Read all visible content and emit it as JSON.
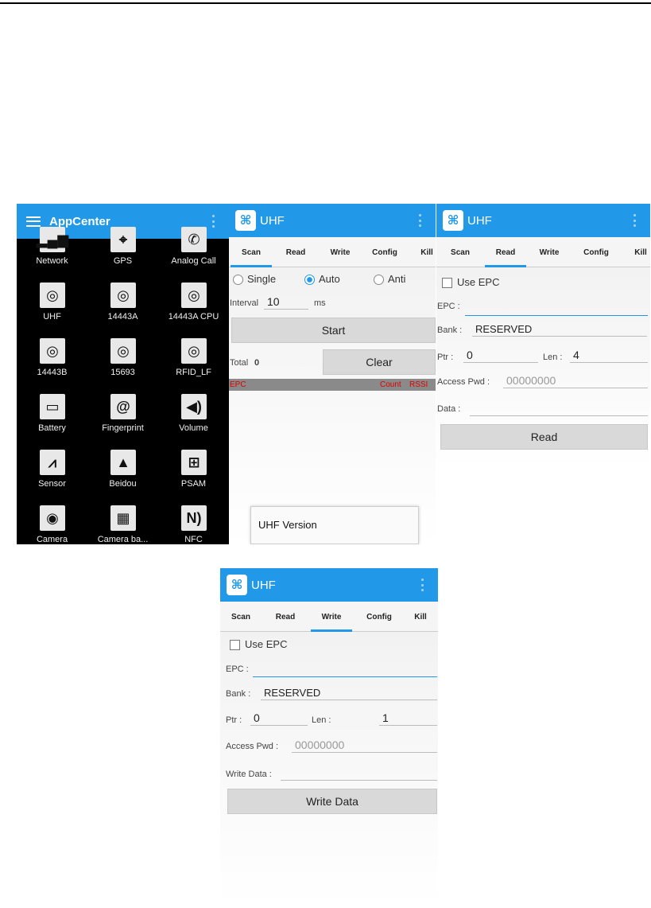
{
  "appcenter": {
    "title": "AppCenter",
    "apps": [
      {
        "label": "Network",
        "icon": "network-icon",
        "glyph": "▂▄▆"
      },
      {
        "label": "GPS",
        "icon": "gps-icon",
        "glyph": "⌖"
      },
      {
        "label": "Analog Call",
        "icon": "phone-icon",
        "glyph": "✆"
      },
      {
        "label": "UHF",
        "icon": "rfid-icon",
        "glyph": "◎"
      },
      {
        "label": "14443A",
        "icon": "rfid-icon",
        "glyph": "◎"
      },
      {
        "label": "14443A CPU",
        "icon": "rfid-icon",
        "glyph": "◎"
      },
      {
        "label": "14443B",
        "icon": "rfid-icon",
        "glyph": "◎"
      },
      {
        "label": "15693",
        "icon": "rfid-icon",
        "glyph": "◎"
      },
      {
        "label": "RFID_LF",
        "icon": "rfid-icon",
        "glyph": "◎"
      },
      {
        "label": "Battery",
        "icon": "battery-icon",
        "glyph": "▭"
      },
      {
        "label": "Fingerprint",
        "icon": "fingerprint-icon",
        "glyph": "@"
      },
      {
        "label": "Volume",
        "icon": "volume-icon",
        "glyph": "◀)"
      },
      {
        "label": "Sensor",
        "icon": "sensor-icon",
        "glyph": "⩘"
      },
      {
        "label": "Beidou",
        "icon": "beidou-icon",
        "glyph": "▲"
      },
      {
        "label": "PSAM",
        "icon": "sim-card-icon",
        "glyph": "⊞"
      },
      {
        "label": "Camera",
        "icon": "camera-icon",
        "glyph": "◉"
      },
      {
        "label": "Camera ba...",
        "icon": "barcode-camera-icon",
        "glyph": "▦"
      },
      {
        "label": "NFC",
        "icon": "nfc-icon",
        "glyph": "N)"
      }
    ]
  },
  "uhf": {
    "title": "UHF",
    "logo_glyph": "⌘",
    "tabs": [
      "Scan",
      "Read",
      "Write",
      "Config",
      "Kill"
    ]
  },
  "scan": {
    "radio_single": "Single",
    "radio_auto": "Auto",
    "radio_anti": "Anti",
    "interval_label": "Interval",
    "interval_value": "10",
    "interval_unit": "ms",
    "start_button": "Start",
    "total_label": "Total",
    "total_value": "0",
    "clear_button": "Clear",
    "col_epc": "EPC",
    "col_count": "Count",
    "col_rssi": "RSSI",
    "menu_item": "UHF Version"
  },
  "read": {
    "use_epc": "Use EPC",
    "epc_label": "EPC :",
    "bank_label": "Bank :",
    "bank_value": "RESERVED",
    "ptr_label": "Ptr :",
    "ptr_value": "0",
    "len_label": "Len :",
    "len_value": "4",
    "pwd_label": "Access Pwd :",
    "pwd_placeholder": "00000000",
    "data_label": "Data :",
    "read_button": "Read"
  },
  "write": {
    "use_epc": "Use EPC",
    "epc_label": "EPC :",
    "bank_label": "Bank :",
    "bank_value": "RESERVED",
    "ptr_label": "Ptr :",
    "ptr_value": "0",
    "len_label": "Len :",
    "len_value": "1",
    "pwd_label": "Access Pwd :",
    "pwd_placeholder": "00000000",
    "data_label": "Write Data :",
    "write_button": "Write Data"
  }
}
